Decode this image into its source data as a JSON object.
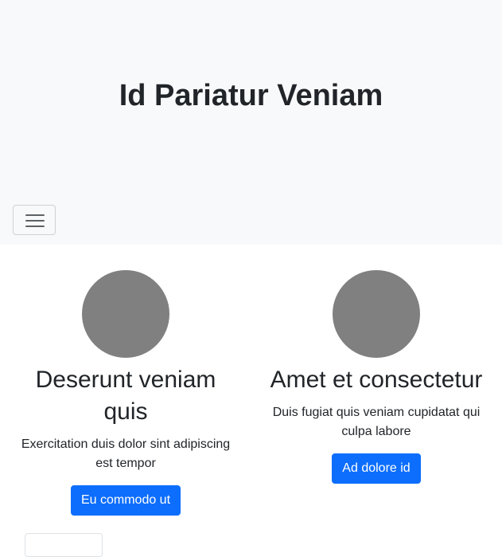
{
  "hero": {
    "title": "Id Pariatur Veniam"
  },
  "navbar": {
    "toggler_icon": "hamburger-icon"
  },
  "cards": [
    {
      "heading": "Deserunt veniam quis",
      "text": "Exercitation duis dolor sint adipiscing est tempor",
      "button_label": "Eu commodo ut"
    },
    {
      "heading": "Amet et consectetur",
      "text": "Duis fugiat quis veniam cupidatat qui culpa labore",
      "button_label": "Ad dolore id"
    }
  ],
  "colors": {
    "hero_background": "#f8f9fa",
    "primary_button": "#0d6efd",
    "avatar_placeholder": "#808080"
  }
}
